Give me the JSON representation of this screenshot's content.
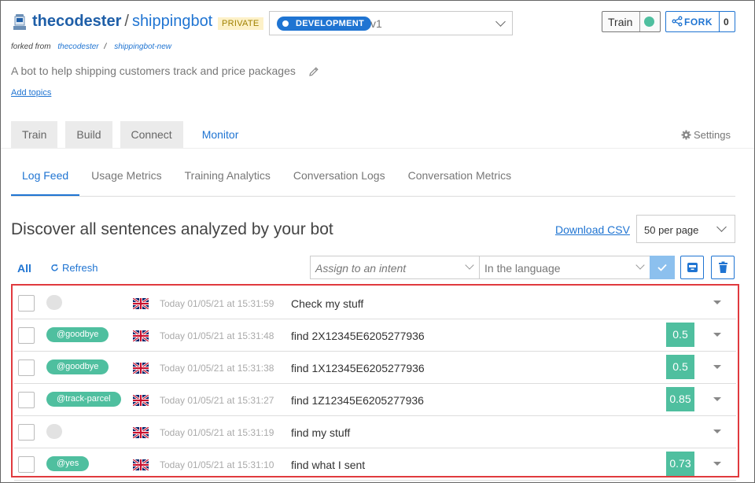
{
  "header": {
    "owner": "thecodester",
    "separator": "/",
    "repo": "shippingbot",
    "visibility_badge": "PRIVATE",
    "environment": {
      "label": "DEVELOPMENT",
      "version": "v1"
    },
    "train_label": "Train",
    "fork_label": "FORK",
    "fork_count": "0",
    "forked_from_label": "forked from",
    "forked_from_owner": "thecodester",
    "forked_from_sep": "/",
    "forked_from_repo": "shippingbot-new",
    "description": "A bot to help shipping customers track and price packages",
    "add_topics": "Add topics"
  },
  "main_tabs": [
    {
      "label": "Train",
      "active": false
    },
    {
      "label": "Build",
      "active": false
    },
    {
      "label": "Connect",
      "active": false
    },
    {
      "label": "Monitor",
      "active": true
    }
  ],
  "settings_label": "Settings",
  "sub_tabs": [
    {
      "label": "Log Feed",
      "active": true
    },
    {
      "label": "Usage Metrics",
      "active": false
    },
    {
      "label": "Training Analytics",
      "active": false
    },
    {
      "label": "Conversation Logs",
      "active": false
    },
    {
      "label": "Conversation Metrics",
      "active": false
    }
  ],
  "log_feed": {
    "heading": "Discover all sentences analyzed by your bot",
    "download_csv": "Download CSV",
    "per_page": "50 per page",
    "all_label": "All",
    "refresh_label": "Refresh",
    "assign_placeholder": "Assign to an intent",
    "language_placeholder": "In the language"
  },
  "rows": [
    {
      "intent": "",
      "timestamp": "Today 01/05/21 at 15:31:59",
      "sentence": "Check my stuff",
      "score": ""
    },
    {
      "intent": "@goodbye",
      "timestamp": "Today 01/05/21 at 15:31:48",
      "sentence": "find 2X12345E6205277936",
      "score": "0.5"
    },
    {
      "intent": "@goodbye",
      "timestamp": "Today 01/05/21 at 15:31:38",
      "sentence": "find 1X12345E6205277936",
      "score": "0.5"
    },
    {
      "intent": "@track-parcel",
      "timestamp": "Today 01/05/21 at 15:31:27",
      "sentence": "find 1Z12345E6205277936",
      "score": "0.85"
    },
    {
      "intent": "",
      "timestamp": "Today 01/05/21 at 15:31:19",
      "sentence": "find my stuff",
      "score": ""
    },
    {
      "intent": "@yes",
      "timestamp": "Today 01/05/21 at 15:31:10",
      "sentence": "find what I sent",
      "score": "0.73"
    }
  ],
  "colors": {
    "accent": "#1f74d2",
    "intent_green": "#4fbf9f",
    "highlight_border": "#e03a3e",
    "private_badge_bg": "#fdf1c8"
  },
  "icons": {
    "bot": "bot-icon",
    "fork": "fork-icon",
    "edit": "pencil-icon",
    "settings": "gear-icon",
    "refresh": "refresh-icon",
    "confirm": "check-icon",
    "archive": "archive-icon",
    "delete": "trash-icon",
    "language": "uk-flag-icon",
    "expand": "caret-down-icon"
  }
}
